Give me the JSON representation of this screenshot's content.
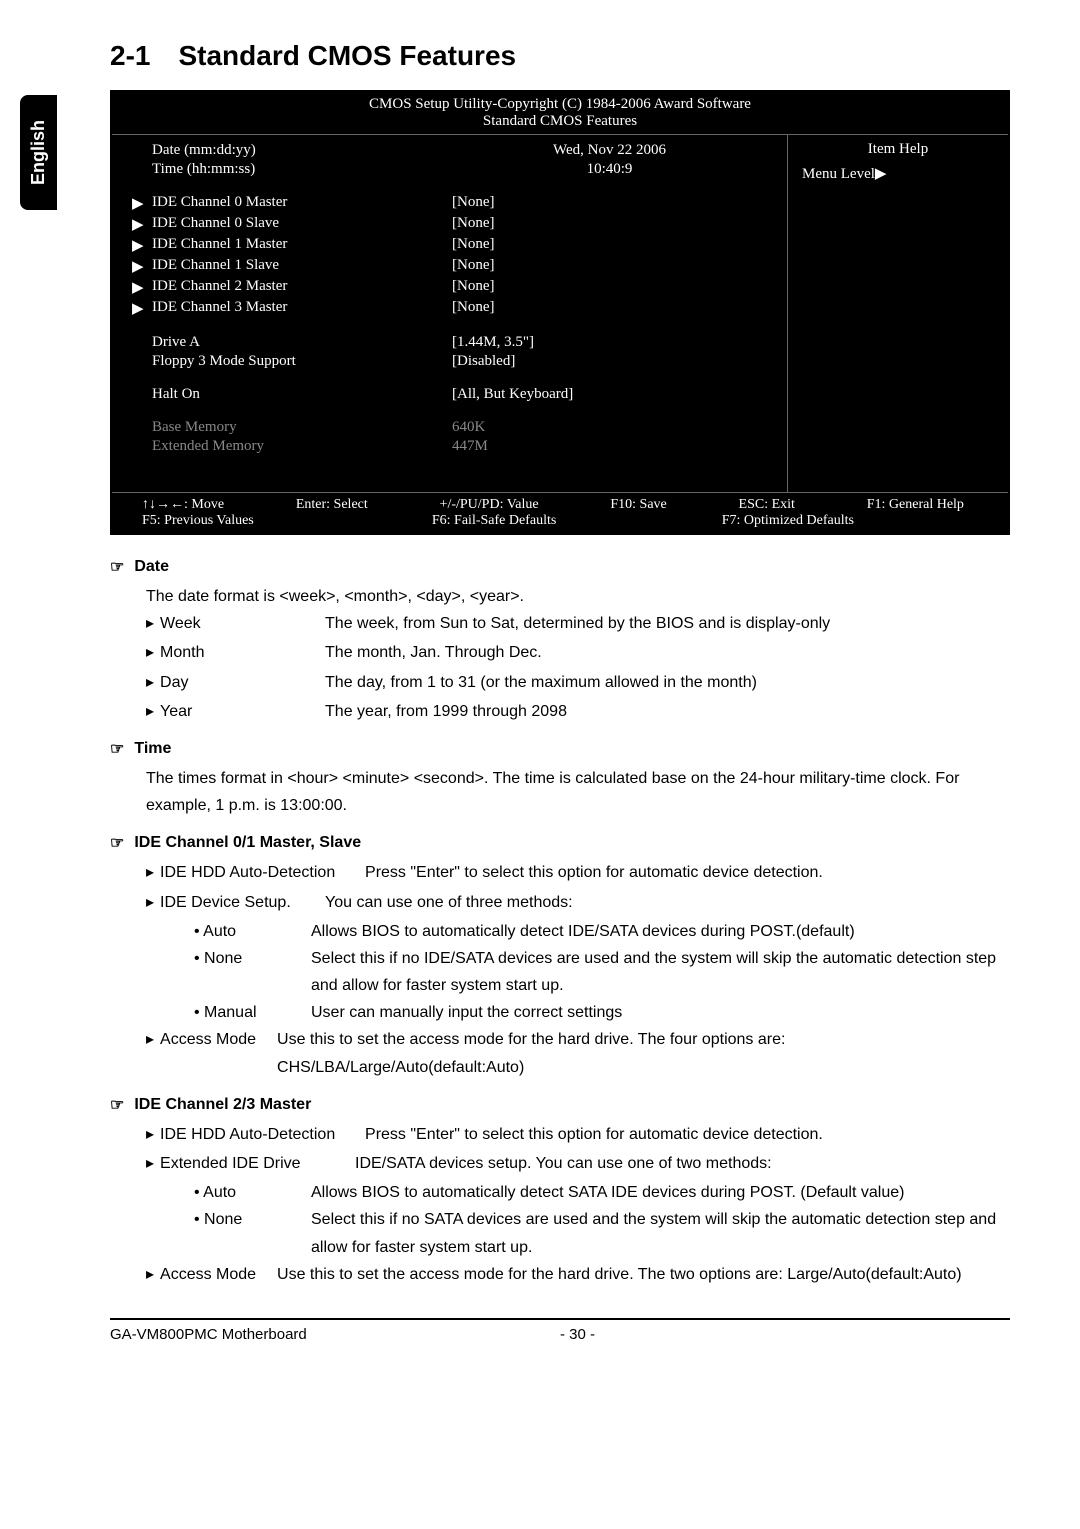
{
  "sidebar": {
    "language": "English"
  },
  "section": {
    "number": "2-1",
    "title": "Standard CMOS Features"
  },
  "bios": {
    "header_line1": "CMOS Setup Utility-Copyright (C) 1984-2006 Award Software",
    "header_line2": "Standard CMOS Features",
    "right_title": "Item Help",
    "right_menulevel": "Menu Level",
    "rows": [
      {
        "marker": "",
        "label": "Date (mm:dd:yy)",
        "value": "Wed, Nov 22 2006",
        "muted": false
      },
      {
        "marker": "",
        "label": "Time (hh:mm:ss)",
        "value": "10:40:9",
        "muted": false
      }
    ],
    "ide_rows": [
      {
        "marker": "▶",
        "label": "IDE Channel 0 Master",
        "value": "[None]"
      },
      {
        "marker": "▶",
        "label": "IDE Channel 0 Slave",
        "value": "[None]"
      },
      {
        "marker": "▶",
        "label": "IDE Channel 1 Master",
        "value": "[None]"
      },
      {
        "marker": "▶",
        "label": "IDE Channel 1 Slave",
        "value": "[None]"
      },
      {
        "marker": "▶",
        "label": "IDE Channel 2 Master",
        "value": "[None]"
      },
      {
        "marker": "▶",
        "label": "IDE Channel 3 Master",
        "value": "[None]"
      }
    ],
    "drive_rows": [
      {
        "marker": "",
        "label": "Drive A",
        "value": "[1.44M, 3.5\"]"
      },
      {
        "marker": "",
        "label": "Floppy 3 Mode Support",
        "value": "[Disabled]"
      }
    ],
    "halt_row": {
      "label": "Halt On",
      "value": "[All, But Keyboard]"
    },
    "memory_rows": [
      {
        "label": "Base Memory",
        "value": "640K"
      },
      {
        "label": "Extended Memory",
        "value": "447M"
      }
    ],
    "footer": [
      "↑↓→←: Move",
      "Enter: Select",
      "+/-/PU/PD: Value",
      "F10: Save",
      "ESC: Exit",
      "F1: General Help",
      "F5: Previous Values",
      "F6: Fail-Safe Defaults",
      "F7: Optimized Defaults"
    ]
  },
  "doc": {
    "date": {
      "heading": "Date",
      "intro": "The date format is <week>, <month>, <day>, <year>.",
      "items": [
        {
          "label": "Week",
          "desc": "The week, from Sun to Sat, determined by the BIOS and is display-only"
        },
        {
          "label": "Month",
          "desc": "The month, Jan. Through Dec."
        },
        {
          "label": "Day",
          "desc": "The day, from 1 to 31 (or the maximum allowed in the month)"
        },
        {
          "label": "Year",
          "desc": "The year, from 1999 through 2098"
        }
      ]
    },
    "time": {
      "heading": "Time",
      "body": "The times format in <hour> <minute> <second>. The time is calculated base on the 24-hour military-time clock. For example, 1 p.m. is 13:00:00."
    },
    "ide01": {
      "heading": "IDE Channel 0/1 Master, Slave",
      "items": [
        {
          "label": "IDE HDD Auto-Detection",
          "desc": "Press \"Enter\" to select this option for automatic device detection."
        },
        {
          "label": "IDE Device Setup.",
          "desc": "You can use one of three methods:"
        }
      ],
      "subitems": [
        {
          "label": "• Auto",
          "desc": "Allows BIOS to automatically detect IDE/SATA devices during POST.(default)"
        },
        {
          "label": "• None",
          "desc": "Select this if no IDE/SATA devices are used and the system will skip the automatic detection step and allow for faster system start up."
        },
        {
          "label": "• Manual",
          "desc": "User can manually input the correct settings"
        }
      ],
      "access": {
        "label": "Access Mode",
        "desc": "Use this to set the access mode for the hard drive. The four options are: CHS/LBA/Large/Auto(default:Auto)"
      }
    },
    "ide23": {
      "heading": "IDE Channel 2/3 Master",
      "items": [
        {
          "label": "IDE HDD Auto-Detection",
          "desc": "Press \"Enter\" to select this option for automatic device detection."
        },
        {
          "label": "Extended IDE Drive",
          "desc": "IDE/SATA devices setup. You can use one of two methods:"
        }
      ],
      "subitems": [
        {
          "label": "• Auto",
          "desc": "Allows BIOS to automatically detect SATA IDE devices during POST. (Default value)"
        },
        {
          "label": "• None",
          "desc": "Select this if no SATA devices are used and the system will skip the automatic detection step and allow for faster system start up."
        }
      ],
      "access": {
        "label": "Access Mode",
        "desc": "Use this to set the access mode for the hard drive. The two options are: Large/Auto(default:Auto)"
      }
    }
  },
  "footer": {
    "product": "GA-VM800PMC Motherboard",
    "page": "- 30 -"
  }
}
